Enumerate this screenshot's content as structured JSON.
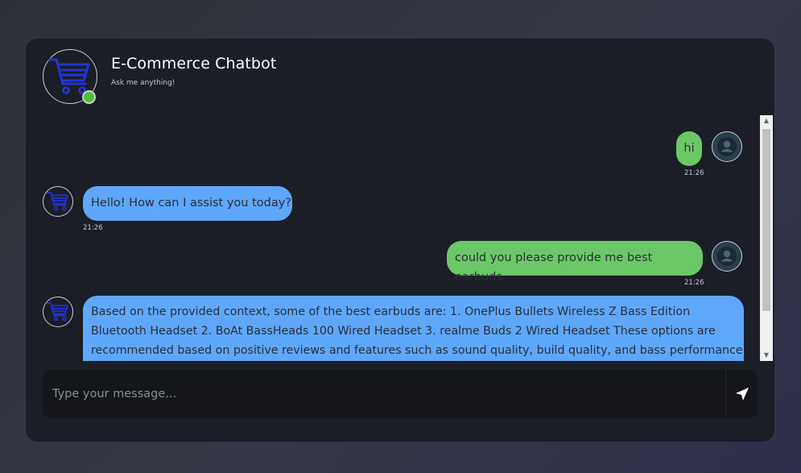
{
  "header": {
    "title": "E-Commerce Chatbot",
    "subtitle": "Ask me anything!",
    "logo_icon": "shopping-cart-icon",
    "status": "online"
  },
  "messages": [
    {
      "sender": "user",
      "text": "hi",
      "time": "21:26",
      "avatar_icon": "user-icon"
    },
    {
      "sender": "bot",
      "text": "Hello! How can I assist you today?",
      "time": "21:26",
      "avatar_icon": "shopping-cart-icon"
    },
    {
      "sender": "user",
      "text": "could you please provide me best earbuds",
      "time": "21:26",
      "avatar_icon": "user-icon"
    },
    {
      "sender": "bot",
      "lines": [
        "Based on the provided context, some of the best earbuds are: 1. OnePlus Bullets Wireless Z Bass Edition",
        "Bluetooth Headset 2. BoAt BassHeads 100 Wired Headset 3. realme Buds 2 Wired Headset These options are",
        "recommended based on positive reviews and features such as sound quality, build quality, and bass performance."
      ],
      "avatar_icon": "shopping-cart-icon"
    }
  ],
  "composer": {
    "placeholder": "Type your message...",
    "value": "",
    "send_icon": "send-icon"
  },
  "colors": {
    "page_bg": "#2e3138",
    "card_bg": "#1b1e26",
    "bot_bubble": "#5ea7fb",
    "user_bubble": "#6bc867",
    "online": "#4cc233",
    "cart_blue": "#2333d6"
  }
}
